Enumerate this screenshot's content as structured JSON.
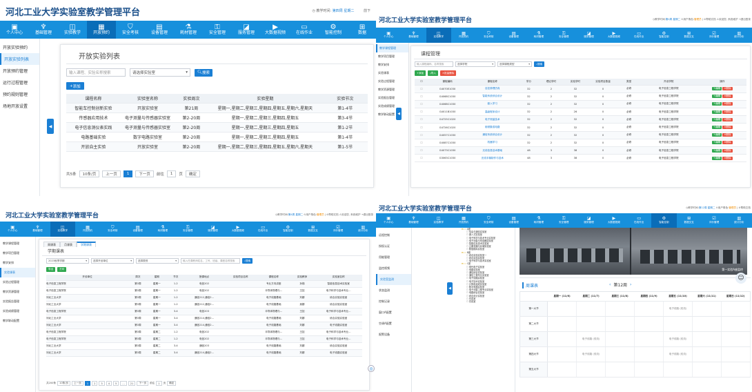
{
  "app_title": "河北工业大学实验室教学管理平台",
  "panel1": {
    "header": {
      "time_label": "教学时间:",
      "time_value": "第四周 星期二",
      "right_cut": "前下"
    },
    "nav": [
      {
        "label": "个人中心",
        "icon": "monitor-icon"
      },
      {
        "label": "基础管理",
        "icon": "sitemap-icon"
      },
      {
        "label": "实验教学",
        "icon": "book-icon"
      },
      {
        "label": "开放预约",
        "icon": "calendar-icon"
      },
      {
        "label": "安全考核",
        "icon": "shield-icon"
      },
      {
        "label": "设备管理",
        "icon": "grid-icon"
      },
      {
        "label": "耗材管理",
        "icon": "flask-icon"
      },
      {
        "label": "安全管理",
        "icon": "lock-icon"
      },
      {
        "label": "服务管理",
        "icon": "chart-icon"
      },
      {
        "label": "大数据视频",
        "icon": "video-icon"
      },
      {
        "label": "在线作业",
        "icon": "doc-icon"
      },
      {
        "label": "智能控制",
        "icon": "control-icon"
      },
      {
        "label": "数据",
        "icon": "data-icon"
      }
    ],
    "side": [
      "开放实验预约",
      "开放实验列表",
      "开放预约管理",
      "运行过程管理",
      "预约规则管理",
      "场地开放设置"
    ],
    "card_title": "开放实验列表",
    "search_placeholder": "输入课程、实验名称搜索",
    "select_lab": "请选择实验室",
    "search_btn": "搜索",
    "add_btn": "添加",
    "columns": [
      "课程名称",
      "实验室名称",
      "实验周次",
      "实验星期",
      "实验节次"
    ],
    "rows": [
      [
        "智能车控制创新实验",
        "开放实验室",
        "第21周",
        "星期一,星期二,星期三,星期四,星期五,星期六,星期天",
        "第1-4节"
      ],
      [
        "传感器应用技术",
        "电子测量与传感器实验室",
        "第2-20周",
        "星期一,星期二,星期三,星期四,星期五",
        "第3-4节"
      ],
      [
        "电子信息测仪表实践",
        "电子测量与传感器实验室",
        "第2-20周",
        "星期一,星期二,星期三,星期四,星期五",
        "第1-2节"
      ],
      [
        "电路基础实验",
        "数字电路实验室",
        "第2-20周",
        "星期一,星期二,星期三,星期四,星期五",
        "第1-4节"
      ],
      [
        "开放自主实验",
        "开放实验室",
        "第2-20周",
        "星期一,星期二,星期三,星期四,星期五,星期六,星期天",
        "第1-5节"
      ]
    ],
    "pager": {
      "total": "共5条",
      "size": "10条/页",
      "prev": "上一页",
      "page": "1",
      "next": "下一页",
      "goto": "前往",
      "goto_val": "1",
      "unit": "页",
      "confirm": "确定"
    }
  },
  "panel2": {
    "header": {
      "time_label": "教学时间:",
      "time_value": "第4周 星期二",
      "role_label": "用户角色:",
      "role_value": "管理员",
      "help": "帮助文档",
      "welcome": "欢迎您, 系统维护",
      "logout": "退出登录"
    },
    "nav": [
      {
        "label": "个人中心",
        "icon": "monitor-icon"
      },
      {
        "label": "基础管理",
        "icon": "sitemap-icon"
      },
      {
        "label": "实验教学",
        "icon": "book-icon"
      },
      {
        "label": "开放预约",
        "icon": "calendar-icon"
      },
      {
        "label": "安全考核",
        "icon": "shield-icon"
      },
      {
        "label": "设备管理",
        "icon": "grid-icon"
      },
      {
        "label": "耗材管理",
        "icon": "flask-icon"
      },
      {
        "label": "安全管理",
        "icon": "lock-icon"
      },
      {
        "label": "服务管理",
        "icon": "chart-icon"
      },
      {
        "label": "大数据视频",
        "icon": "video-icon"
      },
      {
        "label": "在线作业",
        "icon": "doc-icon"
      },
      {
        "label": "智能控制",
        "icon": "control-icon"
      },
      {
        "label": "数据交互",
        "icon": "data-icon"
      },
      {
        "label": "评价管理",
        "icon": "check-icon"
      },
      {
        "label": "统计分析",
        "icon": "stat-icon"
      }
    ],
    "side": [
      "教学课程管理",
      "教学项目管理",
      "教学安排",
      "实验课表",
      "实验过程管理",
      "教学资源管理",
      "实验报告管理",
      "实验成绩管理",
      "教学联动配置"
    ],
    "card_title": "课程管理",
    "search_placeholder": "输入课程编码、名称搜索",
    "select1": "选择学院",
    "select2": "选择课程类型",
    "search_btn": "搜索",
    "add_btn": "添加",
    "import_btn": "导入",
    "delete_btn": "批量删除",
    "columns": [
      "",
      "课程编码",
      "课程名称",
      "学分",
      "理论学时",
      "实验学时",
      "实验项目数量",
      "类型",
      "开设学院",
      "操作"
    ],
    "rows": [
      [
        "G4070E1030",
        "自控原理仿真",
        "32",
        "2",
        "32",
        "0",
        "必修",
        "电子信息工程学院"
      ],
      [
        "G4068C1030",
        "智能系统综合设计",
        "32",
        "2",
        "32",
        "0",
        "必修",
        "电子信息工程学院"
      ],
      [
        "G4068C1030",
        "嵌入学习",
        "32",
        "2",
        "32",
        "0",
        "必修",
        "电子信息工程学院"
      ],
      [
        "G4011B1030",
        "高级程序设计",
        "32",
        "2",
        "26",
        "0",
        "必修",
        "电子信息工程学院"
      ],
      [
        "G4725C1020",
        "电子测量技术",
        "32",
        "2",
        "32",
        "0",
        "必修",
        "电子信息工程学院"
      ],
      [
        "G4726C1020",
        "射频集成电路",
        "32",
        "2",
        "32",
        "0",
        "必修",
        "电子信息工程学院"
      ],
      [
        "G4057C1030",
        "通信系统综合设计",
        "32",
        "2",
        "32",
        "0",
        "必修",
        "电子信息工程学院"
      ],
      [
        "G4087C1030",
        "机器学习",
        "32",
        "2",
        "32",
        "0",
        "必修",
        "电子信息工程学院"
      ],
      [
        "G4073C1030",
        "无线信息技术基础",
        "48",
        "3",
        "38",
        "0",
        "必修",
        "电子信息工程学院"
      ],
      [
        "G3063C1030",
        "无线手機制作与技术",
        "48",
        "3",
        "38",
        "0",
        "必修",
        "电子信息工程学院"
      ]
    ],
    "op_edit": "编辑",
    "op_del": "删除"
  },
  "panel3": {
    "header": {
      "time_label": "教学时间:",
      "time_value": "第4周 星期二",
      "role_label": "用户角色:",
      "role_value": "管理员",
      "help": "帮助文档",
      "welcome": "欢迎您, 系统维护",
      "logout": "退出登录"
    },
    "nav": [
      {
        "label": "个人中心",
        "icon": "monitor-icon"
      },
      {
        "label": "基础管理",
        "icon": "sitemap-icon"
      },
      {
        "label": "实验教学",
        "icon": "book-icon"
      },
      {
        "label": "开放预约",
        "icon": "calendar-icon"
      },
      {
        "label": "安全考核",
        "icon": "shield-icon"
      },
      {
        "label": "设备管理",
        "icon": "grid-icon"
      },
      {
        "label": "耗材管理",
        "icon": "flask-icon"
      },
      {
        "label": "安全管理",
        "icon": "lock-icon"
      },
      {
        "label": "服务管理",
        "icon": "chart-icon"
      },
      {
        "label": "大数据视频",
        "icon": "video-icon"
      },
      {
        "label": "在线作业",
        "icon": "doc-icon"
      },
      {
        "label": "智能控制",
        "icon": "control-icon"
      },
      {
        "label": "数据交互",
        "icon": "data-icon"
      },
      {
        "label": "评价管理",
        "icon": "check-icon"
      },
      {
        "label": "统计分析",
        "icon": "stat-icon"
      }
    ],
    "side": [
      "教学课程管理",
      "教学项目管理",
      "教学安排",
      "实验课表",
      "实验过程管理",
      "教学资源管理",
      "实验报告管理",
      "实验成绩管理",
      "教学联动配置"
    ],
    "tabs": [
      "周课表",
      "月课表",
      "学期课表"
    ],
    "card_title": "学期课表",
    "term": "2023秋季学期",
    "select1": "选择开设单位",
    "select2": "选择类别",
    "search_placeholder": "输入任课教师姓名、工号、班级、课程名称搜索",
    "search_btn": "搜索",
    "export_btn": "导出",
    "print_btn": "打印",
    "columns": [
      "开设单位",
      "周次",
      "星期",
      "节次",
      "授课地点",
      "实验项目名称",
      "课程名称",
      "实验教师",
      "实验室名称"
    ],
    "rows": [
      [
        "电子信息工程学院",
        "第3周",
        "星期一",
        "1-2",
        "电信202",
        "",
        "专业方向讲座",
        "孙娣",
        "智能信息技术实验室"
      ],
      [
        "电子信息工程学院",
        "第3周",
        "星期一",
        "1-2",
        "电信202",
        "",
        "半导体物理与...",
        "王如",
        "电子科学与技术专业..."
      ],
      [
        "河北工业大学",
        "第3周",
        "星期一",
        "1-2",
        "通信212,通信2...",
        "",
        "电子线路基础",
        "刘娜",
        "综合实验实验室"
      ],
      [
        "河北工业大学",
        "第3周",
        "星期一",
        "1-2",
        "通信212,通信2...",
        "",
        "电子线路基础",
        "吴娜",
        "综合实验实验室"
      ],
      [
        "电子信息工程学院",
        "第3周",
        "星期一",
        "3-4",
        "电信203",
        "",
        "半导体物理与...",
        "王如",
        "电子科学与技术专业..."
      ],
      [
        "河北工业大学",
        "第3周",
        "星期一",
        "3-4",
        "通信214,通信2...",
        "",
        "电子线路基础",
        "刘娜",
        "综合实验实验室"
      ],
      [
        "河北工业大学",
        "第3周",
        "星期一",
        "3-4",
        "通信214,通信2...",
        "",
        "电子线路基础",
        "刘娜",
        "电子线路实验室"
      ],
      [
        "电子信息工程学院",
        "第3周",
        "星期二",
        "1-2",
        "电信202",
        "",
        "半导体物理与...",
        "王如",
        "电子科学与技术专业..."
      ],
      [
        "电子信息工程学院",
        "第3周",
        "星期二",
        "1-2",
        "电信202",
        "",
        "半导体物理与...",
        "王如",
        "电子科学与技术专业..."
      ],
      [
        "河北工业大学",
        "第3周",
        "星期二",
        "3-4",
        "通信203",
        "",
        "电子线路基础",
        "刘娜",
        "综合实验实验室"
      ],
      [
        "河北工业大学",
        "第3周",
        "星期二",
        "3-4",
        "通信214,通信2...",
        "",
        "电子线路基础",
        "刘娜",
        "电子线路实验室"
      ]
    ],
    "pager": {
      "total": "共200条",
      "size": "10条/页",
      "prev": "上一页",
      "pages": [
        "1",
        "2",
        "3",
        "4",
        "5",
        "...",
        "21"
      ],
      "next": "下一页",
      "goto": "前往",
      "goto_val": "1",
      "unit": "页",
      "confirm": "确定"
    }
  },
  "panel4": {
    "header": {
      "time_label": "教学时间:",
      "time_value": "第12周 星期二",
      "role_label": "用户角色:",
      "role_value": "管理员",
      "help": "帮助文档"
    },
    "nav": [
      {
        "label": "个人中心",
        "icon": "monitor-icon"
      },
      {
        "label": "基础管理",
        "icon": "sitemap-icon"
      },
      {
        "label": "实验教学",
        "icon": "book-icon"
      },
      {
        "label": "开放预约",
        "icon": "calendar-icon"
      },
      {
        "label": "安全考核",
        "icon": "shield-icon"
      },
      {
        "label": "设备管理",
        "icon": "grid-icon"
      },
      {
        "label": "耗材管理",
        "icon": "flask-icon"
      },
      {
        "label": "安全管理",
        "icon": "lock-icon"
      },
      {
        "label": "服务管理",
        "icon": "chart-icon"
      },
      {
        "label": "大数据视频",
        "icon": "video-icon"
      },
      {
        "label": "在线作业",
        "icon": "doc-icon"
      },
      {
        "label": "智能控制",
        "icon": "control-icon"
      },
      {
        "label": "数据交互",
        "icon": "data-icon"
      },
      {
        "label": "评价管理",
        "icon": "check-icon"
      },
      {
        "label": "统计分析",
        "icon": "stat-icon"
      }
    ],
    "side": [
      "远程控制",
      "授权认证",
      "用能管理",
      "监控视频",
      "实验室监测",
      "状态监测",
      "控制记录",
      "窗口A配置",
      "空调A配置",
      "报警设备"
    ],
    "tree": [
      "A座",
      "信息与通信实验室",
      "嵌入式实验室",
      "电子科学与技术专业实验室",
      "电子测量与传感器实验室",
      "智能信息技术实验室",
      "云服务器与存储实验室",
      "数值模拟实验室",
      "B座",
      "综合实验实验室一",
      "综合实验实验室",
      "电子科学与技术实验室",
      "C座",
      "现代电子实验室",
      "电路实验室",
      "通信综合实验室",
      "通信工程专业实验室",
      "电子线路实验室",
      "电子技术实验室",
      "计算机组成实验室",
      "数字电路实验室",
      "电子测量工程专业实验室",
      "电路综合实验室",
      "综合设计实验室",
      "仿真室",
      "仿真室"
    ],
    "schedule_title": "周课表",
    "week": "第12周",
    "days": [
      "星期一 (11/6)",
      "星期二 (11/7)",
      "星期三 (11/8)",
      "星期四 (11/9)",
      "星期五 (11/10)",
      "星期六 (11/11)",
      "星期日 (11/12)"
    ],
    "periods": [
      "第一大节",
      "第二大节",
      "第三大节",
      "第四大节",
      "第五大节"
    ],
    "cells": [
      [
        "",
        "",
        "",
        "",
        "电子线路 (双流)",
        "",
        ""
      ],
      [
        "",
        "",
        "",
        "",
        "",
        "",
        ""
      ],
      [
        "",
        "电子线路 (双流)",
        "",
        "",
        "电子线路 (双流)",
        "",
        ""
      ],
      [
        "",
        "电子线路 (双流)",
        "",
        "",
        "电子线路 (双流)",
        "",
        ""
      ],
      [
        "",
        "",
        "",
        "",
        "",
        "",
        ""
      ]
    ],
    "cam_label": "第一实验A座监控"
  },
  "colors": {
    "nav": "#1790dc",
    "nav_active": "#0a6db8",
    "accent": "#1a7fd4",
    "title": "#1a4f8a",
    "green": "#2fa84f",
    "red": "#e8523f",
    "orange": "#f08c00"
  }
}
